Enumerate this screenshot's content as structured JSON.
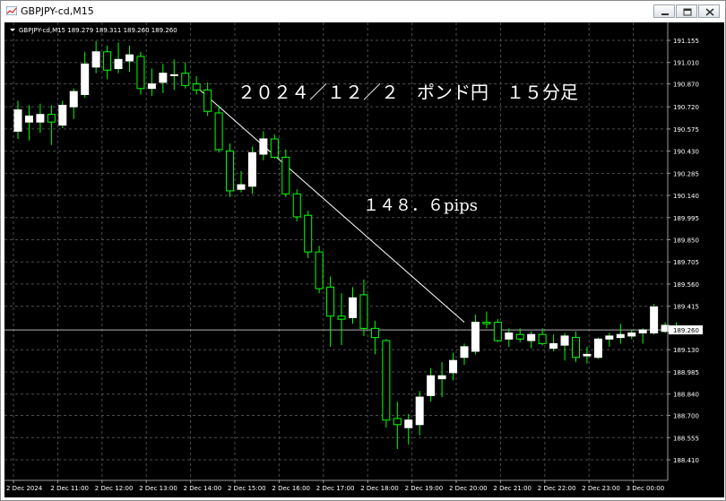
{
  "window": {
    "title": "GBPJPY-cd,M15",
    "controls": [
      "minimize",
      "restore",
      "close"
    ]
  },
  "chart_info": {
    "label": "GBPJPY-cd,M15  189.279 189.311 189.260 189.260",
    "symbol": "GBPJPY-cd",
    "timeframe": "M15",
    "open": 189.279,
    "high": 189.311,
    "low": 189.26,
    "close": 189.26
  },
  "annotations": {
    "title": "２０２４／１２／２　ポンド円　１５分足",
    "pips": "１４８．６pips"
  },
  "colors": {
    "background": "#000000",
    "grid": "#4d4d4d",
    "bull_candle": "#ffffff",
    "bear_candle": "#000000",
    "wick": "#00ff00",
    "axis_text": "#ffffff",
    "current_price_label_bg": "#ffffff"
  },
  "chart_data": {
    "type": "candlestick",
    "ylim": [
      188.41,
      191.155
    ],
    "current_price": 189.26,
    "price_ticks": [
      "191.155",
      "191.010",
      "190.870",
      "190.720",
      "190.575",
      "190.430",
      "190.285",
      "190.140",
      "189.995",
      "189.850",
      "189.705",
      "189.560",
      "189.415",
      "189.130",
      "188.985",
      "188.840",
      "188.700",
      "188.555",
      "188.410"
    ],
    "current_price_label": "189.260",
    "time_labels": [
      "2 Dec 2024",
      "2 Dec 11:00",
      "2 Dec 12:00",
      "2 Dec 13:00",
      "2 Dec 14:00",
      "2 Dec 15:00",
      "2 Dec 16:00",
      "2 Dec 17:00",
      "2 Dec 18:00",
      "2 Dec 19:00",
      "2 Dec 20:00",
      "2 Dec 21:00",
      "2 Dec 22:00",
      "2 Dec 23:00",
      "3 Dec 00:00"
    ],
    "candles": [
      {
        "o": 190.56,
        "h": 190.76,
        "l": 190.51,
        "c": 190.7
      },
      {
        "o": 190.62,
        "h": 190.73,
        "l": 190.5,
        "c": 190.66
      },
      {
        "o": 190.62,
        "h": 190.74,
        "l": 190.55,
        "c": 190.67
      },
      {
        "o": 190.67,
        "h": 190.73,
        "l": 190.47,
        "c": 190.62
      },
      {
        "o": 190.6,
        "h": 190.76,
        "l": 190.58,
        "c": 190.73
      },
      {
        "o": 190.72,
        "h": 190.84,
        "l": 190.64,
        "c": 190.82
      },
      {
        "o": 190.8,
        "h": 191.08,
        "l": 190.78,
        "c": 191.0
      },
      {
        "o": 190.98,
        "h": 191.15,
        "l": 190.94,
        "c": 191.08
      },
      {
        "o": 191.08,
        "h": 191.12,
        "l": 190.9,
        "c": 190.96
      },
      {
        "o": 190.97,
        "h": 191.14,
        "l": 190.94,
        "c": 191.03
      },
      {
        "o": 191.02,
        "h": 191.12,
        "l": 190.95,
        "c": 191.06
      },
      {
        "o": 191.05,
        "h": 191.08,
        "l": 190.8,
        "c": 190.84
      },
      {
        "o": 190.84,
        "h": 190.97,
        "l": 190.79,
        "c": 190.87
      },
      {
        "o": 190.88,
        "h": 191.0,
        "l": 190.81,
        "c": 190.94
      },
      {
        "o": 190.93,
        "h": 191.03,
        "l": 190.83,
        "c": 190.93
      },
      {
        "o": 190.94,
        "h": 191.01,
        "l": 190.84,
        "c": 190.86
      },
      {
        "o": 190.87,
        "h": 190.92,
        "l": 190.8,
        "c": 190.83
      },
      {
        "o": 190.83,
        "h": 190.88,
        "l": 190.66,
        "c": 190.69
      },
      {
        "o": 190.68,
        "h": 190.73,
        "l": 190.42,
        "c": 190.44
      },
      {
        "o": 190.43,
        "h": 190.48,
        "l": 190.13,
        "c": 190.17
      },
      {
        "o": 190.18,
        "h": 190.3,
        "l": 190.16,
        "c": 190.21
      },
      {
        "o": 190.2,
        "h": 190.46,
        "l": 190.15,
        "c": 190.42
      },
      {
        "o": 190.41,
        "h": 190.56,
        "l": 190.37,
        "c": 190.51
      },
      {
        "o": 190.51,
        "h": 190.54,
        "l": 190.38,
        "c": 190.39
      },
      {
        "o": 190.39,
        "h": 190.44,
        "l": 190.13,
        "c": 190.15
      },
      {
        "o": 190.15,
        "h": 190.18,
        "l": 189.97,
        "c": 190.0
      },
      {
        "o": 190.01,
        "h": 190.04,
        "l": 189.73,
        "c": 189.77
      },
      {
        "o": 189.77,
        "h": 189.81,
        "l": 189.5,
        "c": 189.53
      },
      {
        "o": 189.54,
        "h": 189.61,
        "l": 189.15,
        "c": 189.35
      },
      {
        "o": 189.35,
        "h": 189.5,
        "l": 189.16,
        "c": 189.33
      },
      {
        "o": 189.34,
        "h": 189.54,
        "l": 189.3,
        "c": 189.47
      },
      {
        "o": 189.49,
        "h": 189.59,
        "l": 189.22,
        "c": 189.27
      },
      {
        "o": 189.27,
        "h": 189.32,
        "l": 189.1,
        "c": 189.21
      },
      {
        "o": 189.19,
        "h": 189.2,
        "l": 188.62,
        "c": 188.67
      },
      {
        "o": 188.68,
        "h": 188.79,
        "l": 188.48,
        "c": 188.64
      },
      {
        "o": 188.62,
        "h": 188.71,
        "l": 188.51,
        "c": 188.67
      },
      {
        "o": 188.64,
        "h": 188.86,
        "l": 188.57,
        "c": 188.82
      },
      {
        "o": 188.83,
        "h": 189.01,
        "l": 188.79,
        "c": 188.96
      },
      {
        "o": 188.94,
        "h": 189.05,
        "l": 188.82,
        "c": 188.96
      },
      {
        "o": 188.98,
        "h": 189.11,
        "l": 188.93,
        "c": 189.06
      },
      {
        "o": 189.08,
        "h": 189.17,
        "l": 189.03,
        "c": 189.15
      },
      {
        "o": 189.12,
        "h": 189.36,
        "l": 189.1,
        "c": 189.31
      },
      {
        "o": 189.31,
        "h": 189.38,
        "l": 189.27,
        "c": 189.3
      },
      {
        "o": 189.31,
        "h": 189.33,
        "l": 189.18,
        "c": 189.19
      },
      {
        "o": 189.2,
        "h": 189.27,
        "l": 189.15,
        "c": 189.24
      },
      {
        "o": 189.23,
        "h": 189.27,
        "l": 189.18,
        "c": 189.2
      },
      {
        "o": 189.19,
        "h": 189.25,
        "l": 189.14,
        "c": 189.23
      },
      {
        "o": 189.23,
        "h": 189.27,
        "l": 189.16,
        "c": 189.17
      },
      {
        "o": 189.14,
        "h": 189.23,
        "l": 189.12,
        "c": 189.17
      },
      {
        "o": 189.16,
        "h": 189.24,
        "l": 189.06,
        "c": 189.22
      },
      {
        "o": 189.21,
        "h": 189.25,
        "l": 189.05,
        "c": 189.08
      },
      {
        "o": 189.09,
        "h": 189.15,
        "l": 189.04,
        "c": 189.1
      },
      {
        "o": 189.08,
        "h": 189.21,
        "l": 189.07,
        "c": 189.2
      },
      {
        "o": 189.2,
        "h": 189.24,
        "l": 189.15,
        "c": 189.22
      },
      {
        "o": 189.21,
        "h": 189.3,
        "l": 189.17,
        "c": 189.23
      },
      {
        "o": 189.22,
        "h": 189.26,
        "l": 189.2,
        "c": 189.24
      },
      {
        "o": 189.24,
        "h": 189.27,
        "l": 189.17,
        "c": 189.26
      },
      {
        "o": 189.24,
        "h": 189.43,
        "l": 189.23,
        "c": 189.41
      },
      {
        "o": 189.25,
        "h": 189.31,
        "l": 189.24,
        "c": 189.29
      },
      {
        "o": 189.28,
        "h": 189.31,
        "l": 189.26,
        "c": 189.26
      }
    ],
    "trendlines": [
      {
        "from_candle": 16,
        "from_price": 190.85,
        "to_candle": 40,
        "to_price": 189.31
      }
    ],
    "grid": true
  }
}
